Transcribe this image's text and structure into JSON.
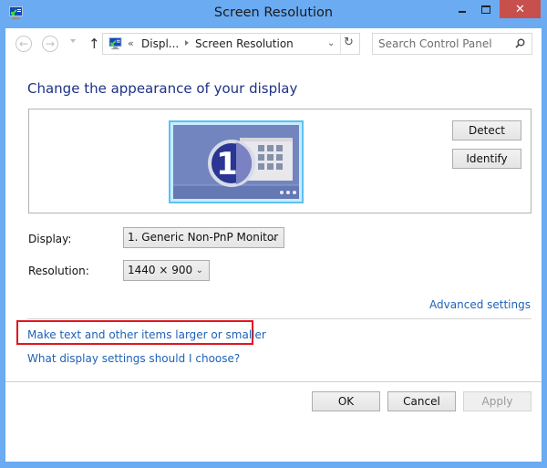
{
  "window": {
    "title": "Screen Resolution",
    "icon": "display-control-panel-icon",
    "controls": {
      "minimize": "minimize-icon",
      "maximize": "maximize-icon",
      "close": "✕"
    }
  },
  "nav": {
    "back": "←",
    "forward": "→",
    "up": "↑",
    "breadcrumb": {
      "overflow": "«",
      "items": [
        "Displ...",
        "Screen Resolution"
      ]
    },
    "dropdown": "⌄",
    "refresh": "↻",
    "search_placeholder": "Search Control Panel"
  },
  "main": {
    "heading": "Change the appearance of your display",
    "monitor": {
      "number": "1"
    },
    "detect_label": "Detect",
    "identify_label": "Identify",
    "display_label": "Display:",
    "display_value": "1. Generic Non-PnP Monitor",
    "resolution_label": "Resolution:",
    "resolution_value": "1440 × 900",
    "chevron": "⌄",
    "advanced_link": "Advanced settings",
    "text_size_link": "Make text and other items larger or smaller",
    "help_link": "What display settings should I choose?"
  },
  "footer": {
    "ok_label": "OK",
    "cancel_label": "Cancel",
    "apply_label": "Apply"
  },
  "colors": {
    "frame": "#6aabf2",
    "close": "#c7504c",
    "heading": "#1e3287",
    "link": "#1f62b7",
    "highlight": "#e3151f"
  }
}
